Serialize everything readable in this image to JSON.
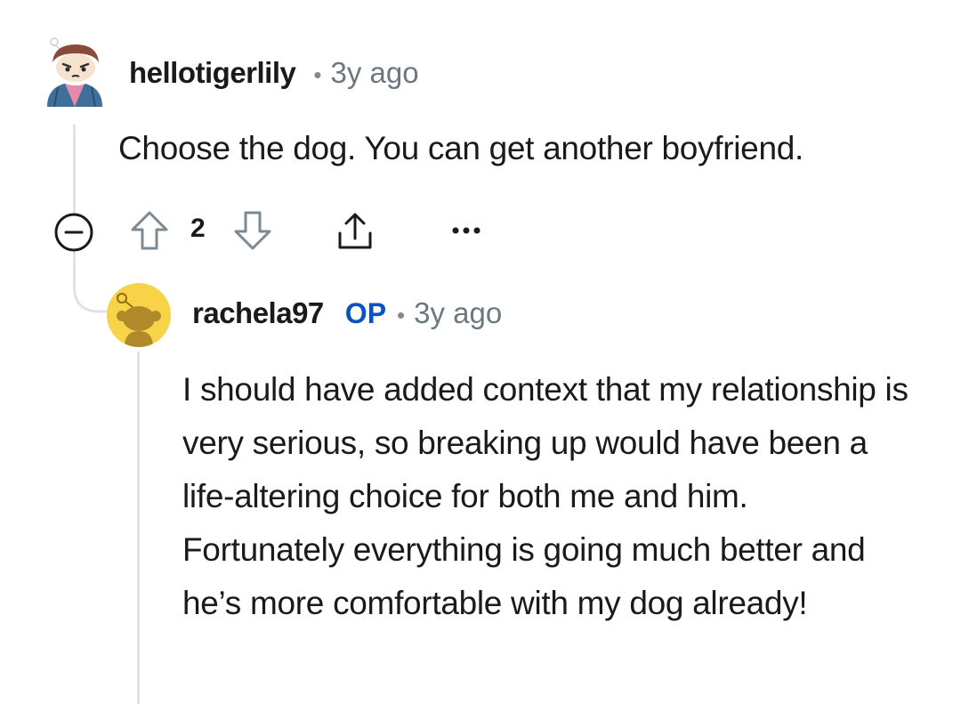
{
  "comment": {
    "author": "hellotigerlily",
    "time": "3y ago",
    "separator": "•",
    "body": "Choose the dog. You can get another boyfriend.",
    "votes": "2",
    "avatar_icon": "snoo-avatar-icon"
  },
  "reply": {
    "author": "rachela97",
    "badge": "OP",
    "time": "3y ago",
    "separator": "•",
    "body": "I should have added context that my relationship is very serious, so breaking up would have been a life-altering choice for both me and him. Fortunately everything is going much better and he’s more comfortable with my dog already!",
    "avatar_icon": "default-snoo-avatar-icon"
  },
  "actions": {
    "collapse_icon": "collapse-minus-icon",
    "upvote_icon": "upvote-arrow-icon",
    "downvote_icon": "downvote-arrow-icon",
    "share_icon": "share-icon",
    "more_icon": "more-options-icon"
  },
  "colors": {
    "op_badge": "#0a52c4",
    "thread_line": "#e0e3e6",
    "reply_avatar_bg": "#f8d348"
  }
}
